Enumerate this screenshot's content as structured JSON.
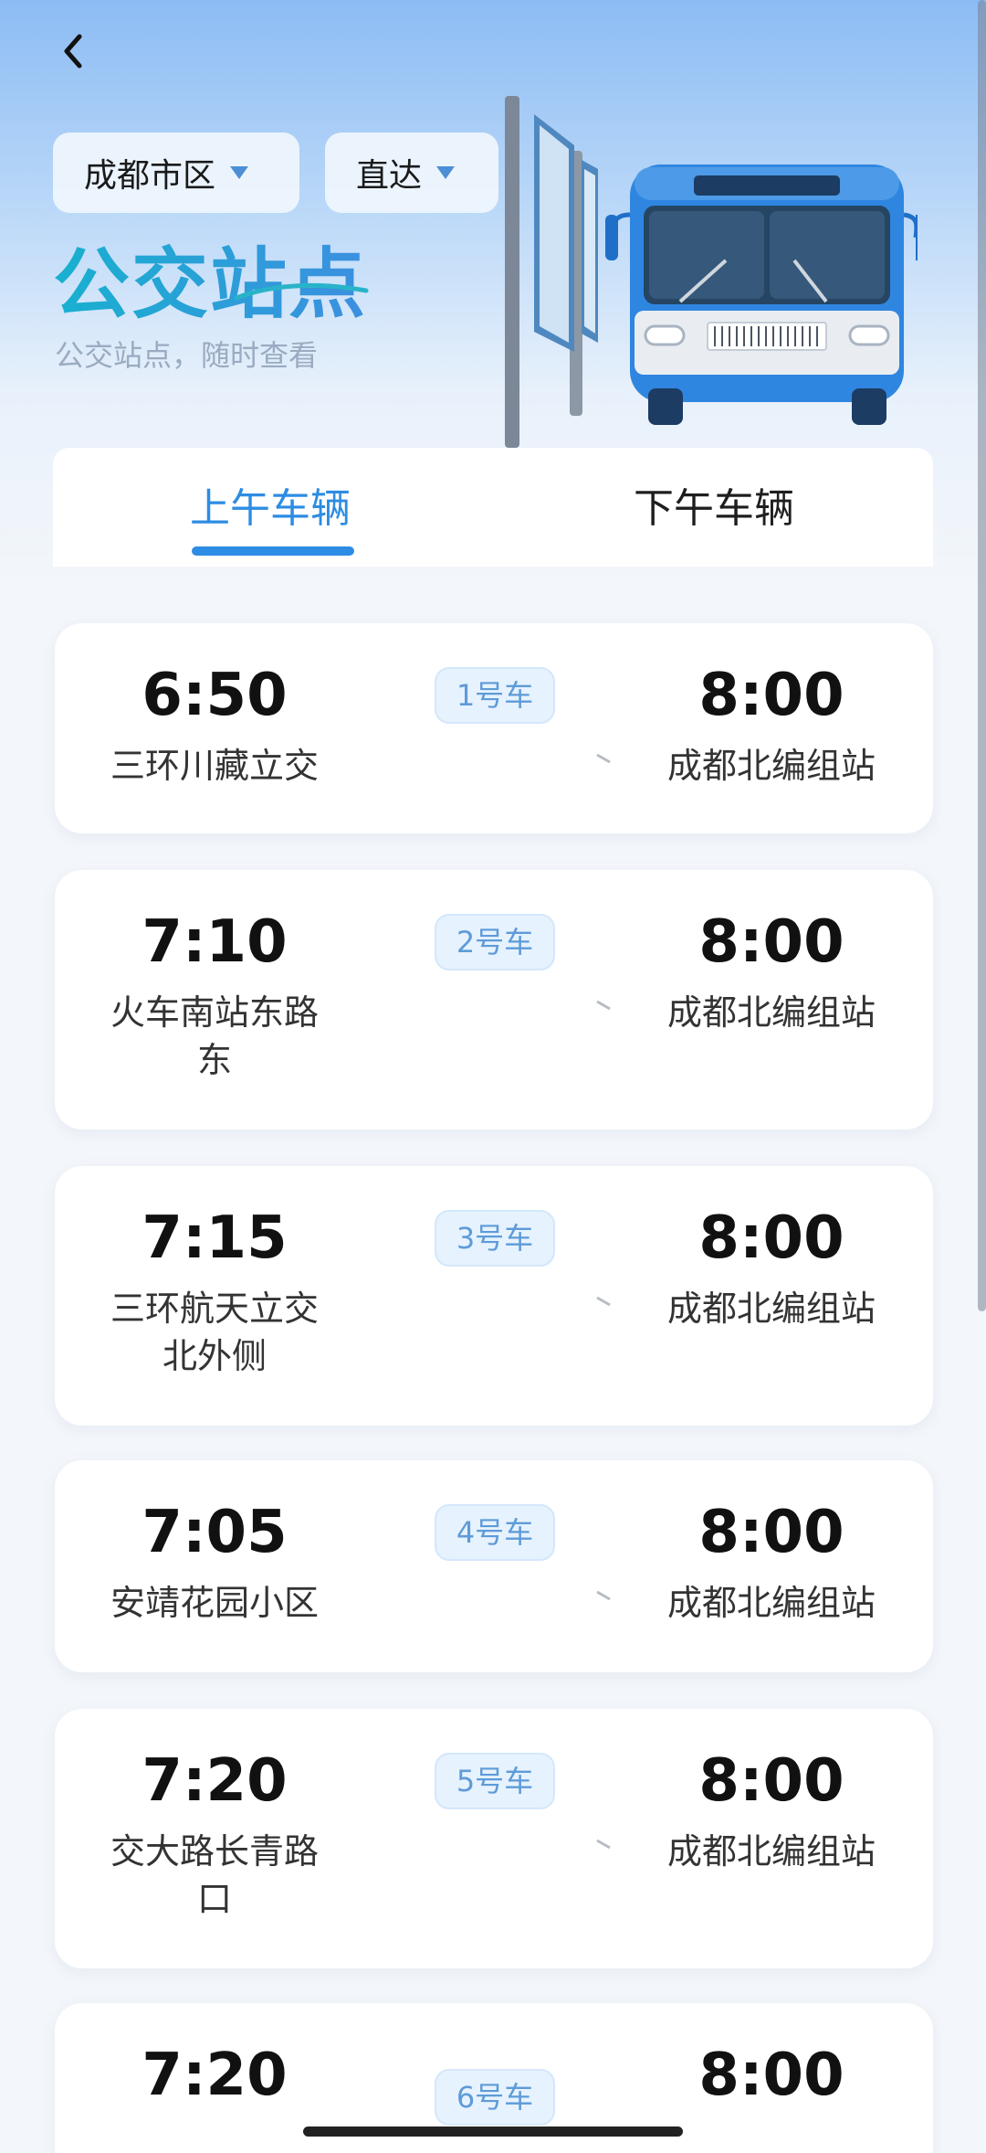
{
  "header": {
    "back_icon": "chevron-left-icon",
    "district_dropdown": "成都市区",
    "type_dropdown": "直达",
    "title": "公交站点",
    "subtitle": "公交站点，随时查看"
  },
  "tabs": [
    {
      "label": "上午车辆",
      "active": true
    },
    {
      "label": "下午车辆",
      "active": false
    }
  ],
  "trips": [
    {
      "depart_time": "6:50",
      "depart_stop": "三环川藏立交",
      "bus": "1号车",
      "arrive_time": "8:00",
      "arrive_stop": "成都北编组站"
    },
    {
      "depart_time": "7:10",
      "depart_stop": "火车南站东路东",
      "bus": "2号车",
      "arrive_time": "8:00",
      "arrive_stop": "成都北编组站"
    },
    {
      "depart_time": "7:15",
      "depart_stop": "三环航天立交北外侧",
      "bus": "3号车",
      "arrive_time": "8:00",
      "arrive_stop": "成都北编组站"
    },
    {
      "depart_time": "7:05",
      "depart_stop": "安靖花园小区",
      "bus": "4号车",
      "arrive_time": "8:00",
      "arrive_stop": "成都北编组站"
    },
    {
      "depart_time": "7:20",
      "depart_stop": "交大路长青路口",
      "bus": "5号车",
      "arrive_time": "8:00",
      "arrive_stop": "成都北编组站"
    },
    {
      "depart_time": "7:20",
      "depart_stop": "",
      "bus": "6号车",
      "arrive_time": "8:00",
      "arrive_stop": ""
    }
  ],
  "colors": {
    "accent": "#2d8ce3",
    "badge_bg": "#e6f2fd",
    "badge_text": "#5e9bd8"
  }
}
